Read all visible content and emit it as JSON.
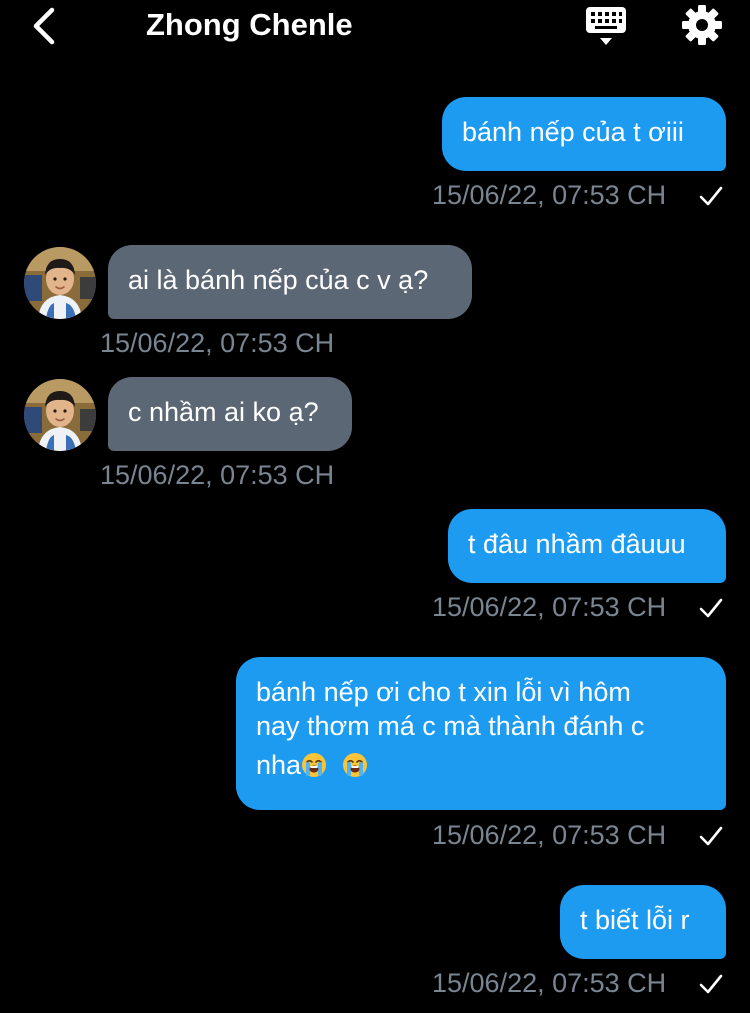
{
  "header": {
    "title": "Zhong Chenle",
    "back_icon": "chevron-left-icon",
    "keyboard_icon": "keyboard-icon",
    "settings_icon": "gear-icon"
  },
  "colors": {
    "background": "#000000",
    "outgoing_bubble": "#1d9bf0",
    "incoming_bubble": "#5b6774",
    "timestamp": "#7a8592"
  },
  "messages": [
    {
      "direction": "outgoing",
      "text": "bánh nếp của t ơiii",
      "time": "15/06/22, 07:53 CH",
      "read": true
    },
    {
      "direction": "incoming",
      "text": "ai là bánh nếp của c v ạ?",
      "time": "15/06/22, 07:53 CH"
    },
    {
      "direction": "incoming",
      "text": "c nhầm ai ko ạ?",
      "time": "15/06/22, 07:53 CH"
    },
    {
      "direction": "outgoing",
      "text": "t đâu nhầm đâuuu",
      "time": "15/06/22, 07:53 CH",
      "read": true
    },
    {
      "direction": "outgoing",
      "lines": [
        "bánh nếp ơi cho t xin lỗi vì hôm",
        "nay thơm má c mà thành đánh c",
        "nha"
      ],
      "emojis": [
        "loudly-crying-face",
        "loudly-crying-face"
      ],
      "time": "15/06/22, 07:53 CH",
      "read": true
    },
    {
      "direction": "outgoing",
      "text": "t biết lỗi r",
      "time": "15/06/22, 07:53 CH",
      "read": true
    }
  ]
}
